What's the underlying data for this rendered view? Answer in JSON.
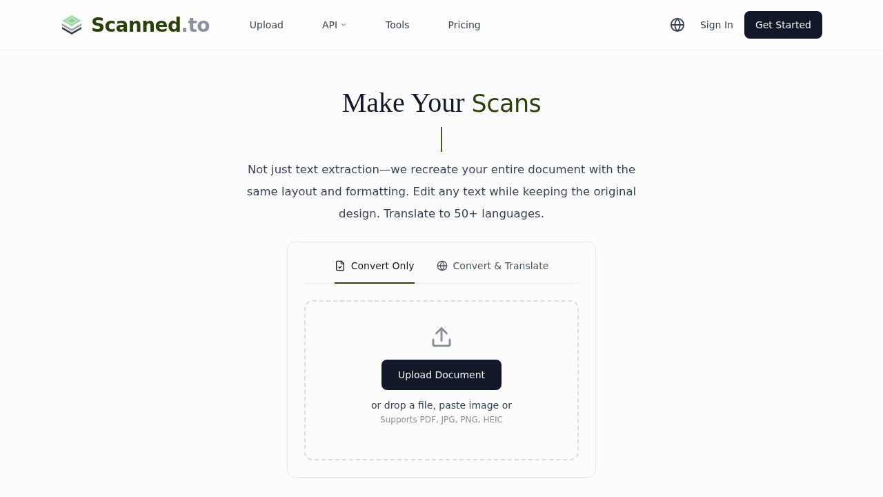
{
  "header": {
    "logo": {
      "name": "Scanned",
      "suffix": ".to"
    },
    "nav": [
      {
        "label": "Upload",
        "kind": "link"
      },
      {
        "label": "API",
        "kind": "dropdown"
      },
      {
        "label": "Tools",
        "kind": "link"
      },
      {
        "label": "Pricing",
        "kind": "link"
      }
    ],
    "sign_in": "Sign In",
    "cta": "Get Started"
  },
  "hero": {
    "title": "Make Your",
    "title_highlight": "Scans",
    "description": "Not just text extraction—we recreate your entire document with the same layout and formatting. Edit any text while keeping the original design. Translate to 50+ languages."
  },
  "upload_card": {
    "tabs": [
      {
        "label": "Convert Only",
        "selected": true
      },
      {
        "label": "Convert & Translate",
        "selected": false
      }
    ],
    "button": "Upload Document",
    "hint": "or drop a file, paste image or",
    "formats": "Supports PDF, JPG, PNG, HEIC"
  }
}
